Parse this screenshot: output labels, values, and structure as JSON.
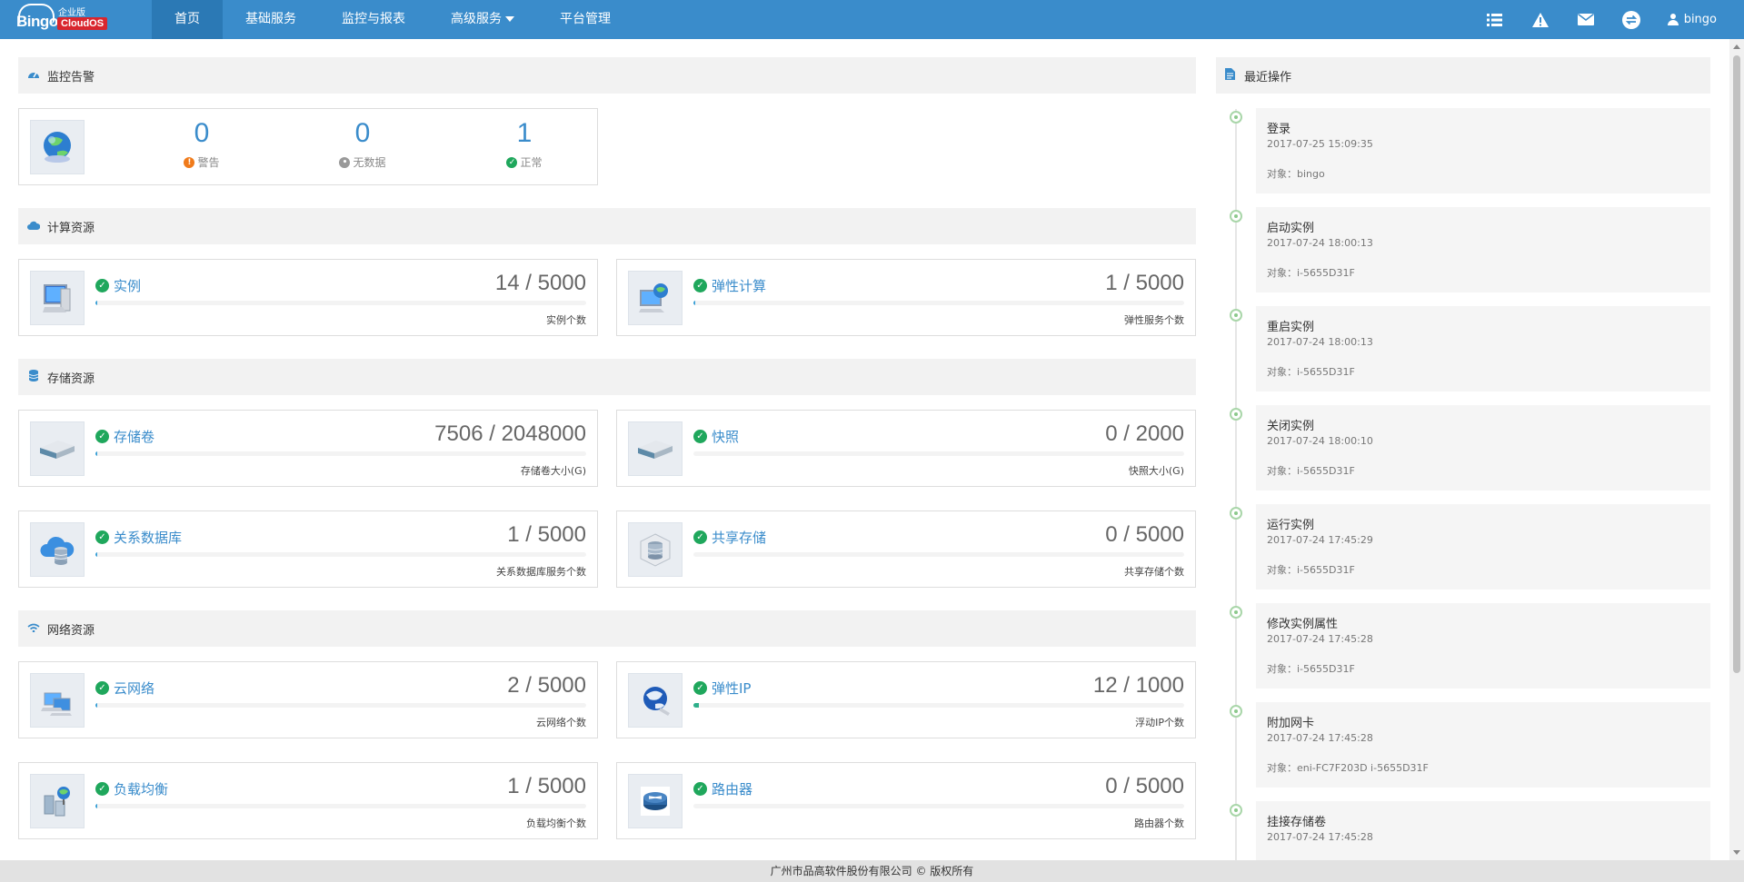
{
  "brand": {
    "edition": "企业版",
    "name": "Bingo",
    "product": "CloudOS"
  },
  "nav": [
    {
      "label": "首页",
      "active": true
    },
    {
      "label": "基础服务"
    },
    {
      "label": "监控与报表"
    },
    {
      "label": "高级服务",
      "dropdown": true
    },
    {
      "label": "平台管理"
    }
  ],
  "topbar": {
    "icons": [
      "list-icon",
      "warning-icon",
      "mail-icon",
      "switch-icon"
    ],
    "username": "bingo"
  },
  "sections": {
    "monitor": "监控告警",
    "compute": "计算资源",
    "storage": "存储资源",
    "network": "网络资源",
    "recent": "最近操作"
  },
  "monitor": {
    "alarm": {
      "value": "0",
      "label": "警告",
      "color": "#f07b1b"
    },
    "nodata": {
      "value": "0",
      "label": "无数据",
      "color": "#999999"
    },
    "normal": {
      "value": "1",
      "label": "正常",
      "color": "#1fa75c"
    }
  },
  "resources": {
    "instance": {
      "title": "实例",
      "count": "14 / 5000",
      "sub": "实例个数",
      "used": 14,
      "total": 5000
    },
    "autoscale": {
      "title": "弹性计算",
      "count": "1 / 5000",
      "sub": "弹性服务个数",
      "used": 1,
      "total": 5000
    },
    "volume": {
      "title": "存储卷",
      "count": "7506 / 2048000",
      "sub": "存储卷大小(G)",
      "used": 7506,
      "total": 2048000
    },
    "snapshot": {
      "title": "快照",
      "count": "0 / 2000",
      "sub": "快照大小(G)",
      "used": 0,
      "total": 2000
    },
    "rdb": {
      "title": "关系数据库",
      "count": "1 / 5000",
      "sub": "关系数据库服务个数",
      "used": 1,
      "total": 5000
    },
    "share": {
      "title": "共享存储",
      "count": "0 / 5000",
      "sub": "共享存储个数",
      "used": 0,
      "total": 5000
    },
    "vpc": {
      "title": "云网络",
      "count": "2 / 5000",
      "sub": "云网络个数",
      "used": 2,
      "total": 5000
    },
    "eip": {
      "title": "弹性IP",
      "count": "12 / 1000",
      "sub": "浮动IP个数",
      "used": 12,
      "total": 1000
    },
    "lb": {
      "title": "负载均衡",
      "count": "1 / 5000",
      "sub": "负载均衡个数",
      "used": 1,
      "total": 5000
    },
    "router": {
      "title": "路由器",
      "count": "0 / 5000",
      "sub": "路由器个数",
      "used": 0,
      "total": 5000
    }
  },
  "operations": [
    {
      "name": "登录",
      "time": "2017-07-25 15:09:35",
      "target": "对象：bingo"
    },
    {
      "name": "启动实例",
      "time": "2017-07-24 18:00:13",
      "target": "对象：i-5655D31F"
    },
    {
      "name": "重启实例",
      "time": "2017-07-24 18:00:13",
      "target": "对象：i-5655D31F"
    },
    {
      "name": "关闭实例",
      "time": "2017-07-24 18:00:10",
      "target": "对象：i-5655D31F"
    },
    {
      "name": "运行实例",
      "time": "2017-07-24 17:45:29",
      "target": "对象：i-5655D31F"
    },
    {
      "name": "修改实例属性",
      "time": "2017-07-24 17:45:28",
      "target": "对象：i-5655D31F"
    },
    {
      "name": "附加网卡",
      "time": "2017-07-24 17:45:28",
      "target": "对象：eni-FC7F203D i-5655D31F"
    },
    {
      "name": "挂接存储卷",
      "time": "2017-07-24 17:45:28",
      "target": ""
    }
  ],
  "footer": "广州市品高软件股份有限公司 © 版权所有"
}
